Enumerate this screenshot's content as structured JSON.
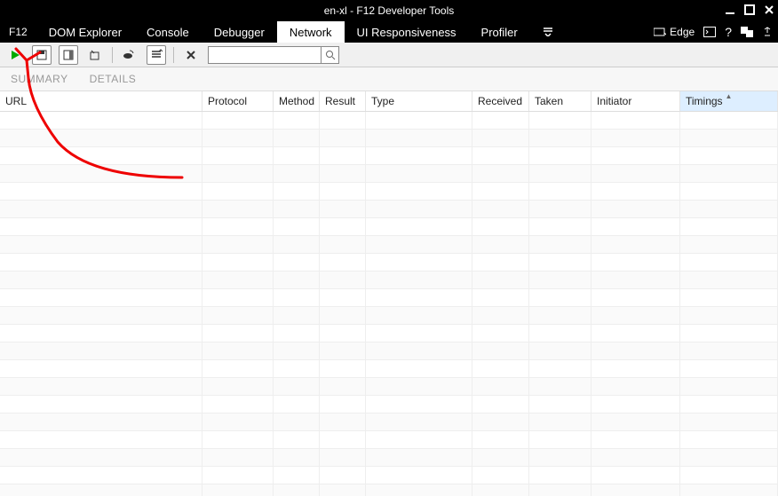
{
  "window": {
    "title": "en-xl - F12 Developer Tools"
  },
  "menubar": {
    "f12": "F12",
    "tabs": [
      {
        "label": "DOM Explorer"
      },
      {
        "label": "Console"
      },
      {
        "label": "Debugger"
      },
      {
        "label": "Network"
      },
      {
        "label": "UI Responsiveness"
      },
      {
        "label": "Profiler"
      }
    ],
    "active_index": 3,
    "edge_label": "Edge"
  },
  "toolbar": {
    "search_placeholder": ""
  },
  "subtabs": {
    "summary": "SUMMARY",
    "details": "DETAILS"
  },
  "grid": {
    "columns": {
      "url": "URL",
      "protocol": "Protocol",
      "method": "Method",
      "result": "Result",
      "type": "Type",
      "received": "Received",
      "taken": "Taken",
      "initiator": "Initiator",
      "timings": "Timings"
    },
    "sorted_column": "timings",
    "rows": []
  }
}
